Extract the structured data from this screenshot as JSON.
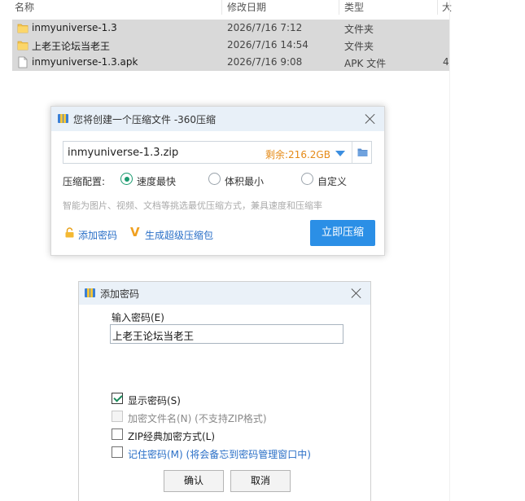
{
  "explorer": {
    "columns": [
      "名称",
      "修改日期",
      "类型",
      "大"
    ],
    "files": [
      {
        "name": "inmyuniverse-1.3",
        "date": "2026/7/16 7:12",
        "type": "文件夹",
        "size": "",
        "icon": "folder-icon"
      },
      {
        "name": "上老王论坛当老王",
        "date": "2026/7/16 14:54",
        "type": "文件夹",
        "size": "",
        "icon": "folder-icon"
      },
      {
        "name": "inmyuniverse-1.3.apk",
        "date": "2026/7/16 9:08",
        "type": "APK 文件",
        "size": "4",
        "icon": "file-icon"
      }
    ]
  },
  "compress_dialog": {
    "title": "您将创建一个压缩文件 -360压缩",
    "filename": "inmyuniverse-1.3.zip",
    "free_space": "剩余:216.2GB",
    "config_label": "压缩配置:",
    "options": [
      {
        "label": "速度最快",
        "selected": true
      },
      {
        "label": "体积最小",
        "selected": false
      },
      {
        "label": "自定义",
        "selected": false
      }
    ],
    "hint": "智能为图片、视频、文档等挑选最优压缩方式，兼具速度和压缩率",
    "add_password": "添加密码",
    "super_package": "生成超级压缩包",
    "compress_button": "立即压缩"
  },
  "password_dialog": {
    "title": "添加密码",
    "input_label": "输入密码(E)",
    "password_value": "上老王论坛当老王",
    "checkboxes": [
      {
        "label": "显示密码(S)",
        "checked": true,
        "enabled": true
      },
      {
        "label": "加密文件名(N) (不支持ZIP格式)",
        "checked": false,
        "enabled": false
      },
      {
        "label": "ZIP经典加密方式(L)",
        "checked": false,
        "enabled": true
      },
      {
        "label": "记住密码(M) (将会备忘到密码管理窗口中)",
        "checked": false,
        "enabled": true
      }
    ],
    "ok_button": "确认",
    "cancel_button": "取消"
  },
  "colors": {
    "accent_blue": "#2b8fe6",
    "free_space_orange": "#e58a17",
    "radio_green": "#1a9b6f",
    "selection_gray": "#d9d9d9"
  }
}
